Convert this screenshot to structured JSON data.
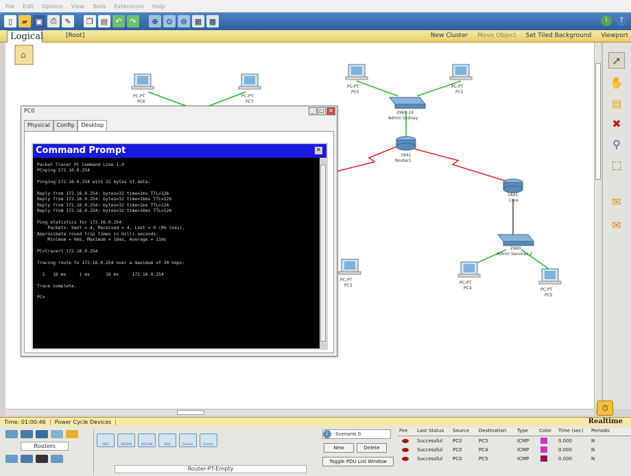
{
  "menubar": {
    "items": [
      "File",
      "Edit",
      "Options",
      "View",
      "Tools",
      "Extensions",
      "Help"
    ]
  },
  "workspace": {
    "logical_label": "Logical",
    "root_label": "[Root]",
    "new_cluster": "New Cluster",
    "move_object": "Move Object",
    "set_tiled_background": "Set Tiled Background",
    "viewport": "Viewport"
  },
  "devices": [
    {
      "name": "PC-PT",
      "label": "PC6"
    },
    {
      "name": "PC-PT",
      "label": "PC7"
    },
    {
      "name": "PC-PT",
      "label": "PC0"
    },
    {
      "name": "PC-PT",
      "label": "PC1"
    },
    {
      "name": "2960-24",
      "label": "Admin Sydney"
    },
    {
      "name": "1841",
      "label": "Router1"
    },
    {
      "name": "1841",
      "label": "Core"
    },
    {
      "name": "2960",
      "label": "Admin Services 2"
    },
    {
      "name": "PC-PT",
      "label": "PC4"
    },
    {
      "name": "PC-PT",
      "label": "PC5"
    },
    {
      "name": "PC-PT",
      "label": "PC3"
    }
  ],
  "pc_window": {
    "title": "PC0",
    "tabs": [
      "Physical",
      "Config",
      "Desktop"
    ],
    "active_tab": "Desktop",
    "cmd_title": "Command Prompt",
    "cmd_lines": [
      "Packet Tracer PC Command Line 1.0",
      "PC>ping 172.16.0.254",
      "",
      "Pinging 172.16.0.254 with 32 bytes of data:",
      "",
      "Reply from 172.16.0.254: bytes=32 time=1ms TTL=126",
      "Reply from 172.16.0.254: bytes=32 time=16ms TTL=126",
      "Reply from 172.16.0.254: bytes=32 time=1ms TTL=126",
      "Reply from 172.16.0.254: bytes=32 time=16ms TTL=126",
      "",
      "Ping statistics for 172.16.0.254:",
      "    Packets: Sent = 4, Received = 4, Lost = 0 (0% loss),",
      "Approximate round trip times in milli-seconds:",
      "    Minimum = 0ms, Maximum = 16ms, Average = 11ms",
      "",
      "PC>tracert 172.16.0.254",
      "",
      "Tracing route to 172.16.0.254 over a maximum of 30 hops:",
      "",
      "  1   16 ms     1 ms      16 ms     172.16.0.254",
      "",
      "Trace complete.",
      "",
      "PC>"
    ]
  },
  "status": {
    "time": "Time: 01:00:46",
    "power": "Power Cycle Devices",
    "realtime": "Realtime"
  },
  "bottom": {
    "category_label": "Routers",
    "device_models": [
      "1841",
      "2620XM",
      "2621XM",
      "2811",
      "Generic",
      "Generic"
    ],
    "device_type_label": "Router-PT-Empty",
    "scenario": "Scenario 0",
    "new_btn": "New",
    "delete_btn": "Delete",
    "toggle_btn": "Toggle PDU List Window"
  },
  "pdu_table": {
    "headers": [
      "Fire",
      "Last Status",
      "Source",
      "Destination",
      "Type",
      "Color",
      "Time (sec)",
      "Periodic"
    ],
    "rows": [
      {
        "status": "Successful",
        "source": "PC0",
        "destination": "PC5",
        "type": "ICMP",
        "color": "#cc33cc",
        "time": "0.000",
        "periodic": "N"
      },
      {
        "status": "Successful",
        "source": "PC0",
        "destination": "PC4",
        "type": "ICMP",
        "color": "#cc33cc",
        "time": "0.000",
        "periodic": "N"
      },
      {
        "status": "Successful",
        "source": "PC0",
        "destination": "PC5",
        "type": "ICMP",
        "color": "#991155",
        "time": "0.000",
        "periodic": "N"
      }
    ]
  },
  "colors": {
    "link_ok": "#22bb22",
    "serial": "#dd2222",
    "titlebar": "#1a1adf"
  }
}
